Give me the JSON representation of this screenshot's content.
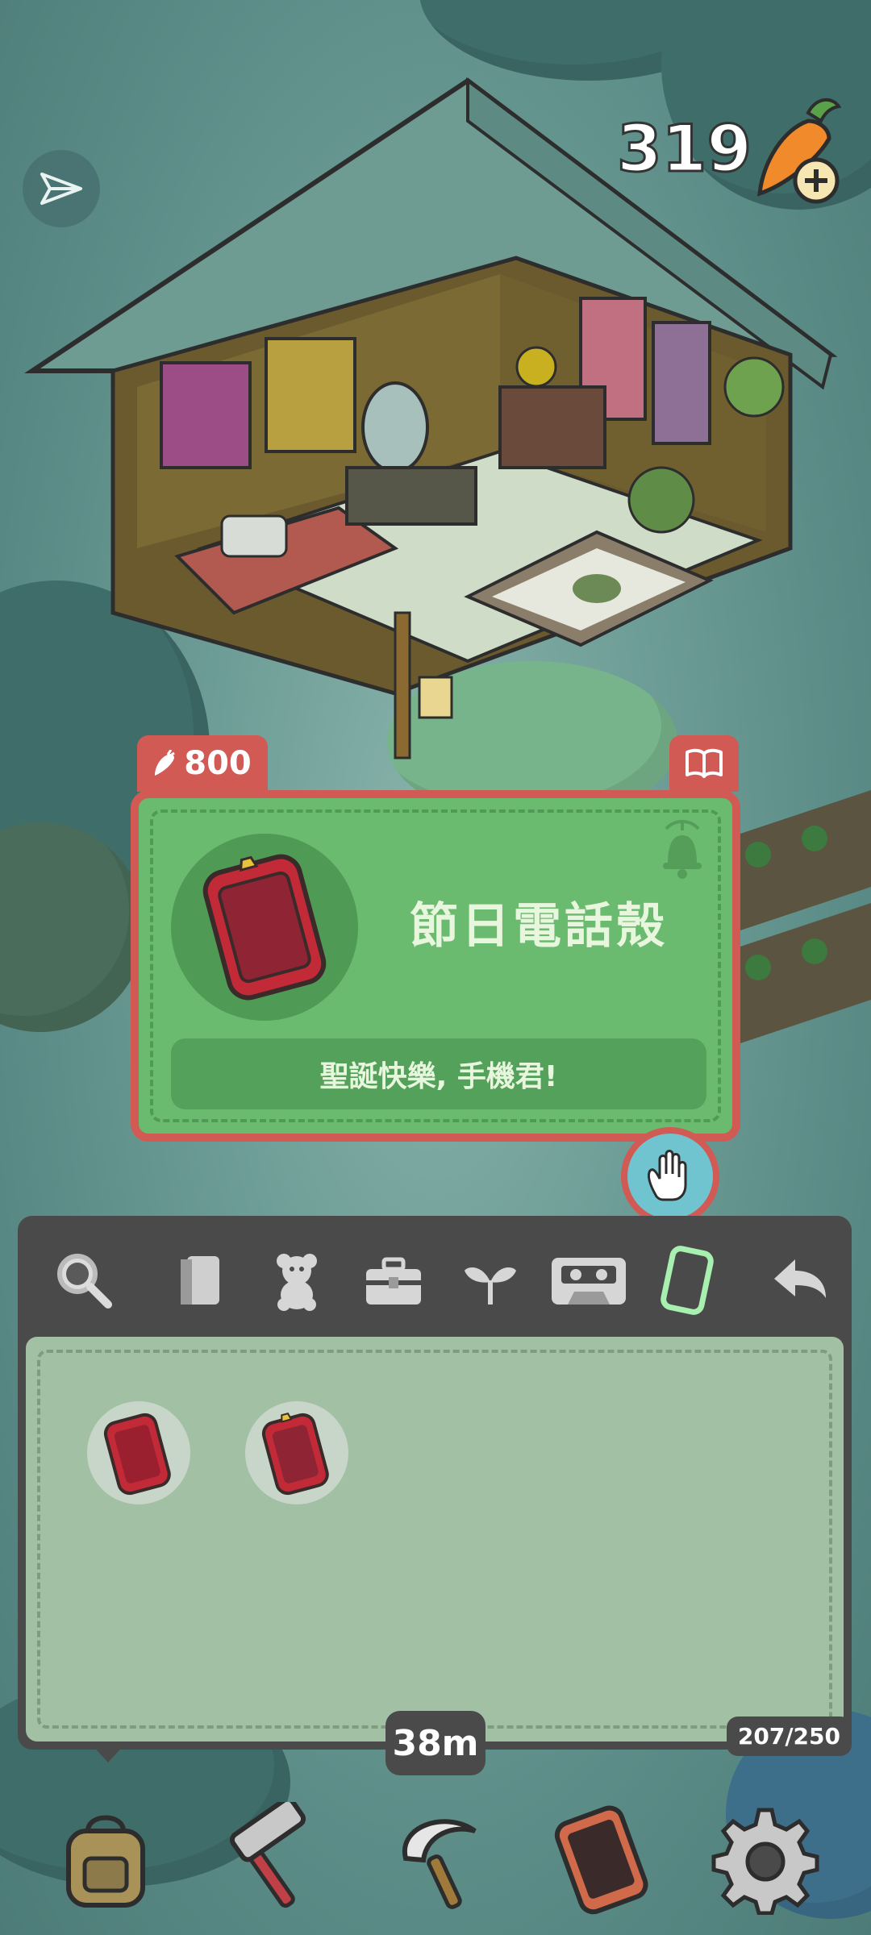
{
  "hud": {
    "carrot_count": "319"
  },
  "card": {
    "price": "800",
    "name": "節日電話殼",
    "description": "聖誕快樂, 手機君!"
  },
  "inventory": {
    "tabs": [
      "search-icon",
      "book-icon",
      "teddy-bear-icon",
      "toolbox-icon",
      "sprout-icon",
      "cassette-icon",
      "phone-case-icon",
      "back-icon"
    ],
    "active_tab": "phone-case-icon",
    "capacity": "207/250",
    "items": [
      "phone-case-red",
      "phone-case-red-gold"
    ]
  },
  "timer": "38m",
  "toolbar": [
    "backpack-icon",
    "hammer-icon",
    "sickle-icon",
    "phone-icon",
    "gear-icon"
  ],
  "colors": {
    "card_green": "#6aba6f",
    "card_border_red": "#d15a55",
    "panel_dark": "#4a4a4a",
    "grid_green": "#a2c0a4",
    "active_tab_green": "#a8f0b0"
  }
}
